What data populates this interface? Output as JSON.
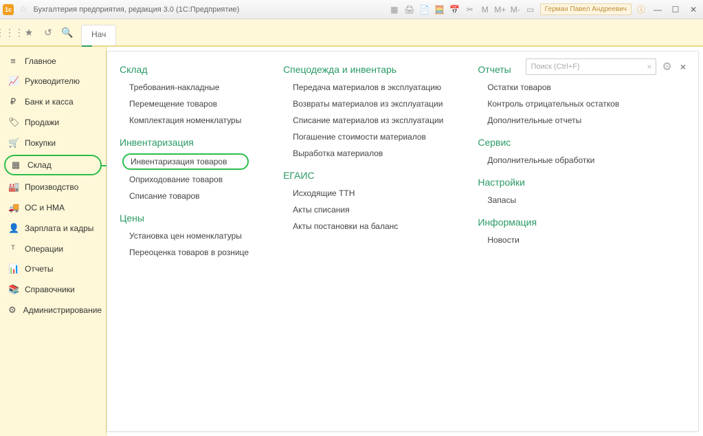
{
  "titlebar": {
    "title": "Бухгалтерия предприятия, редакция 3.0  (1С:Предприятие)",
    "user": "Герман Павел Андреевич",
    "m_labels": [
      "M",
      "M+",
      "M-"
    ]
  },
  "toolbar": {
    "start_tab": "Нач"
  },
  "search": {
    "placeholder": "Поиск (Ctrl+F)"
  },
  "sidebar": [
    {
      "icon": "≡",
      "label": "Главное"
    },
    {
      "icon": "📈",
      "label": "Руководителю"
    },
    {
      "icon": "₽",
      "label": "Банк и касса"
    },
    {
      "icon": "🏷",
      "label": "Продажи"
    },
    {
      "icon": "🛒",
      "label": "Покупки"
    },
    {
      "icon": "▦",
      "label": "Склад",
      "selected": true
    },
    {
      "icon": "🏭",
      "label": "Производство"
    },
    {
      "icon": "🚚",
      "label": "ОС и НМА"
    },
    {
      "icon": "👤",
      "label": "Зарплата и кадры"
    },
    {
      "icon": "ᵀ",
      "label": "Операции"
    },
    {
      "icon": "📊",
      "label": "Отчеты"
    },
    {
      "icon": "📚",
      "label": "Справочники"
    },
    {
      "icon": "⚙",
      "label": "Администрирование"
    }
  ],
  "columns": [
    {
      "sections": [
        {
          "title": "Склад",
          "links": [
            "Требования-накладные",
            "Перемещение товаров",
            "Комплектация номенклатуры"
          ]
        },
        {
          "title": "Инвентаризация",
          "links": [
            "Инвентаризация товаров",
            "Оприходование товаров",
            "Списание товаров"
          ],
          "highlight_index": 0
        },
        {
          "title": "Цены",
          "links": [
            "Установка цен номенклатуры",
            "Переоценка товаров в рознице"
          ]
        }
      ]
    },
    {
      "sections": [
        {
          "title": "Спецодежда и инвентарь",
          "links": [
            "Передача материалов в эксплуатацию",
            "Возвраты материалов из эксплуатации",
            "Списание материалов из эксплуатации",
            "Погашение стоимости материалов",
            "Выработка материалов"
          ]
        },
        {
          "title": "ЕГАИС",
          "links": [
            "Исходящие ТТН",
            "Акты списания",
            "Акты постановки на баланс"
          ]
        }
      ]
    },
    {
      "sections": [
        {
          "title": "Отчеты",
          "links": [
            "Остатки товаров",
            "Контроль отрицательных остатков",
            "Дополнительные отчеты"
          ]
        },
        {
          "title": "Сервис",
          "links": [
            "Дополнительные обработки"
          ]
        },
        {
          "title": "Настройки",
          "links": [
            "Запасы"
          ]
        },
        {
          "title": "Информация",
          "links": [
            "Новости"
          ]
        }
      ]
    }
  ]
}
